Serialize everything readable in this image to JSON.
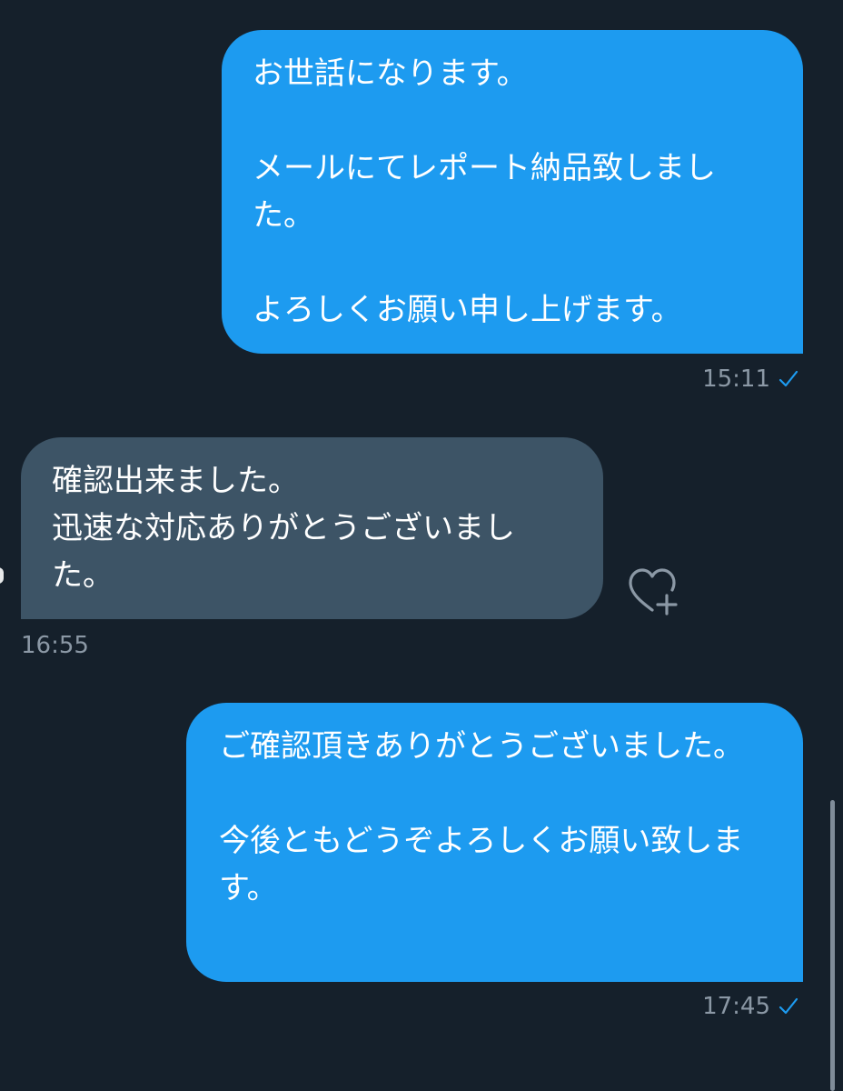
{
  "messages": [
    {
      "direction": "outgoing",
      "text": "お世話になります。\n\nメールにてレポート納品致しました。\n\nよろしくお願い申し上げます。",
      "time": "15:11",
      "status_icon": "check-icon"
    },
    {
      "direction": "incoming",
      "text": "確認出来ました。\n迅速な対応ありがとうございました。",
      "time": "16:55",
      "reaction_icon": "heart-plus-icon"
    },
    {
      "direction": "outgoing",
      "text": "ご確認頂きありがとうございました。\n\n今後ともどうぞよろしくお願い致します。",
      "time": "17:45",
      "status_icon": "check-icon"
    }
  ],
  "colors": {
    "background": "#15202b",
    "outgoing_bubble": "#1d9bf0",
    "incoming_bubble": "#3d5466",
    "meta_text": "#8b98a5",
    "check": "#1d9bf0"
  }
}
